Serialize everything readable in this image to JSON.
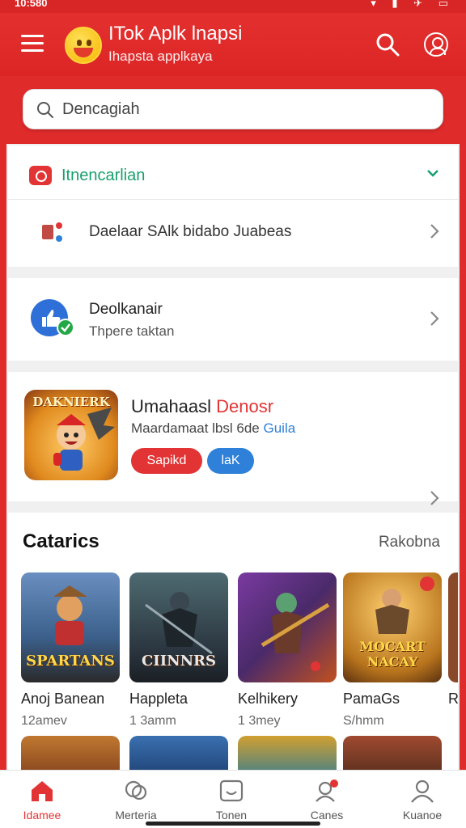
{
  "status_bar": {
    "time": "10:580"
  },
  "app_bar": {
    "title": "ITok Aplk lnapsi",
    "subtitle": "Ihapsta applkaya"
  },
  "search": {
    "placeholder": "Dencagiah",
    "value": ""
  },
  "section": {
    "title": "Itnencarlian",
    "row_label": "Daelaar SAlk bidabo Juabeas"
  },
  "row2": {
    "title": "Deolkanair",
    "subtitle": "Thpeгe taktan"
  },
  "featured": {
    "thumb_text": "DAKNIERK",
    "title_main": "Umahaasl ",
    "title_accent": "Denosr",
    "subtitle_main": "Maardamaat lbsl 6de ",
    "subtitle_accent": "Guila",
    "pill_red": "Sapikd",
    "pill_blue": "laK"
  },
  "categories": {
    "title": "Catarics",
    "more": "Rakobna",
    "items": [
      {
        "name": "Anoj Banean",
        "meta": "12amev",
        "art_text": "SPARTANS",
        "art_color": "#3b5f8a"
      },
      {
        "name": "Happleta",
        "meta": "1 3amm",
        "art_text": "CIINNRS",
        "art_color": "#2b3640"
      },
      {
        "name": "Kelhikery",
        "meta": "1 3mey",
        "art_text": "",
        "art_color": "#4a2a6a"
      },
      {
        "name": "PamaGs",
        "meta": "S/hmm",
        "art_text": "MOCART NACAY",
        "art_color": "#b8741c"
      },
      {
        "name": "Ra",
        "meta": "",
        "art_text": "",
        "art_color": "#8a4a2a"
      }
    ]
  },
  "bottom_nav": [
    {
      "label": "Idamee",
      "icon": "home-icon",
      "active": true
    },
    {
      "label": "Merteria",
      "icon": "game-icon",
      "active": false
    },
    {
      "label": "Tonen",
      "icon": "smile-icon",
      "active": false
    },
    {
      "label": "Canes",
      "icon": "user-alert-icon",
      "active": false
    },
    {
      "label": "Kuanoe",
      "icon": "person-icon",
      "active": false
    }
  ],
  "colors": {
    "brand_red": "#e02b2b",
    "accent_green": "#18a06e",
    "accent_blue": "#2f80d8"
  }
}
